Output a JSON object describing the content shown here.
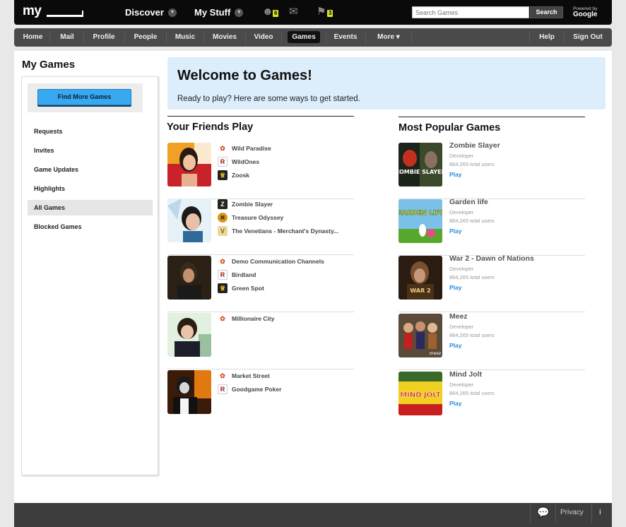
{
  "brand": {
    "logo": "my"
  },
  "topnav": {
    "discover": "Discover",
    "mystuff": "My Stuff",
    "friends_badge": "6",
    "alerts_badge": "3"
  },
  "search": {
    "placeholder": "Search Games",
    "button": "Search",
    "powered_by": "Powered by",
    "powered_brand": "Google"
  },
  "nav": {
    "items": [
      "Home",
      "Mail",
      "Profile",
      "People",
      "Music",
      "Movies",
      "Video",
      "Games",
      "Events",
      "More ▾"
    ],
    "active": "Games",
    "right": [
      "Help",
      "Sign Out"
    ]
  },
  "sidebar": {
    "title": "My Games",
    "find_button": "Find More Games",
    "items": [
      "Requests",
      "Invites",
      "Game Updates",
      "Highlights",
      "All Games",
      "Blocked Games"
    ],
    "active": "All Games"
  },
  "welcome": {
    "title": "Welcome to Games!",
    "subtitle": "Ready to play? Here are some ways to get started."
  },
  "friends": {
    "title": "Your Friends Play",
    "rows": [
      {
        "games": [
          {
            "icon": "paw-icon",
            "name": "Wild Paradise"
          },
          {
            "icon": "r-logo-icon",
            "name": "WildOnes"
          },
          {
            "icon": "crown-icon",
            "name": "Zoosk"
          }
        ]
      },
      {
        "games": [
          {
            "icon": "z-logo-icon",
            "name": "Zombie Slayer"
          },
          {
            "icon": "compass-icon",
            "name": "Treasure Odyssey"
          },
          {
            "icon": "v-logo-icon",
            "name": "The Venetians - Merchant's Dynasty..."
          }
        ]
      },
      {
        "games": [
          {
            "icon": "paw-icon",
            "name": "Demo Communication Channels"
          },
          {
            "icon": "r-logo-icon",
            "name": "Birdland"
          },
          {
            "icon": "crown-icon",
            "name": "Green Spot"
          }
        ]
      },
      {
        "games": [
          {
            "icon": "paw-icon",
            "name": "Millionaire City"
          }
        ]
      },
      {
        "games": [
          {
            "icon": "paw-icon",
            "name": "Market Street"
          },
          {
            "icon": "r-logo-icon",
            "name": "Goodgame Poker"
          }
        ]
      }
    ]
  },
  "popular": {
    "title": "Most Popular Games",
    "rows": [
      {
        "name": "Zombie Slayer",
        "developer": "Developer",
        "users": "864,265 total users",
        "play": "Play",
        "thumb_text": "ZOMBIE SLAYER"
      },
      {
        "name": "Garden life",
        "developer": "Developer",
        "users": "864,265 total users",
        "play": "Play",
        "thumb_text": "GARDEN LIFE"
      },
      {
        "name": "War 2 - Dawn of Nations",
        "developer": "Developer",
        "users": "864,265 total users",
        "play": "Play",
        "thumb_text": "WAR 2"
      },
      {
        "name": "Meez",
        "developer": "Developer",
        "users": "864,265 total users",
        "play": "Play",
        "thumb_text": "meez"
      },
      {
        "name": "Mind Jolt",
        "developer": "Developer",
        "users": "864,265 total users",
        "play": "Play",
        "thumb_text": "MIND JOLT"
      }
    ]
  },
  "footer": {
    "privacy": "Privacy",
    "info": "i"
  }
}
